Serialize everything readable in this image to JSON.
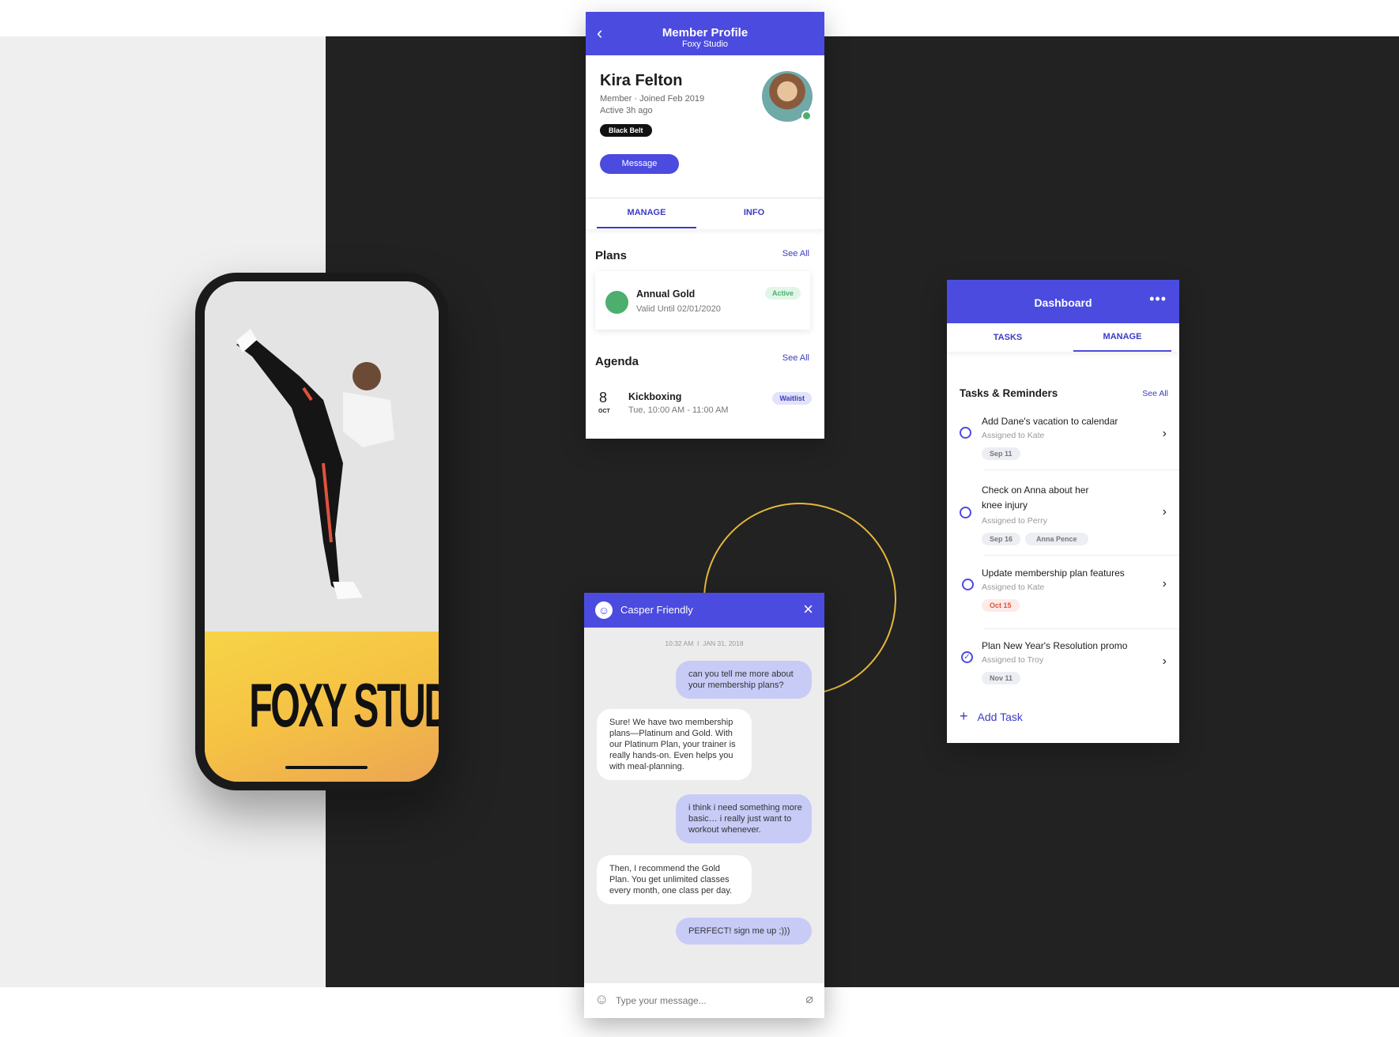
{
  "phone": {
    "logo": "FOXY STUDIO"
  },
  "profile": {
    "title": "Member Profile",
    "subtitle": "Foxy Studio",
    "name": "Kira Felton",
    "meta": "Member · Joined Feb 2019",
    "active": "Active 3h ago",
    "badge": "Black Belt",
    "message_label": "Message",
    "tabs": [
      "MANAGE",
      "INFO"
    ],
    "plans": {
      "heading": "Plans",
      "see_all": "See All",
      "plan_name": "Annual Gold",
      "plan_valid": "Valid Until 02/01/2020",
      "plan_status": "Active"
    },
    "agenda": {
      "heading": "Agenda",
      "see_all": "See All",
      "day": "8",
      "month": "OCT",
      "event": "Kickboxing",
      "time": "Tue, 10:00 AM - 11:00 AM",
      "status": "Waitlist"
    }
  },
  "chat": {
    "name": "Casper Friendly",
    "timestamp": "10:32 AM  I  JAN 31, 2018",
    "messages": [
      {
        "from": "me",
        "text": "can you tell me more about your membership plans?"
      },
      {
        "from": "them",
        "text": "Sure! We have two membership plans—Platinum and Gold. With our Platinum Plan, your trainer is really hands-on. Even helps you with meal-planning."
      },
      {
        "from": "me",
        "text": "i think i need something more basic… i really just want to workout whenever."
      },
      {
        "from": "them",
        "text": "Then, I recommend the Gold Plan. You get unlimited classes every month, one class per day."
      },
      {
        "from": "me",
        "text": "PERFECT! sign me up ;)))"
      }
    ],
    "placeholder": "Type your message..."
  },
  "dashboard": {
    "title": "Dashboard",
    "tabs": [
      "TASKS",
      "MANAGE"
    ],
    "active_tab": "MANAGE",
    "heading": "Tasks & Reminders",
    "see_all": "See All",
    "tasks": [
      {
        "title": "Add Dane's vacation to calendar",
        "assignee": "Assigned to Kate",
        "tags": [
          "Sep 11"
        ],
        "done": false
      },
      {
        "title": "Check on Anna about her knee injury",
        "assignee": "Assigned to Perry",
        "tags": [
          "Sep 16",
          "Anna Pence"
        ],
        "done": false
      },
      {
        "title": "Update membership plan features",
        "assignee": "Assigned to Kate",
        "tags": [
          "Oct 15"
        ],
        "done": false,
        "overdue": true
      },
      {
        "title": "Plan New Year's Resolution promo",
        "assignee": "Assigned to Troy",
        "tags": [
          "Nov 11"
        ],
        "done": true
      }
    ],
    "add_task": "Add Task"
  },
  "colors": {
    "accent": "#4b4be0",
    "dark_bg": "#222223",
    "ring": "#e6b83a",
    "active_green": "#4caf6e",
    "overdue": "#e0533c"
  }
}
